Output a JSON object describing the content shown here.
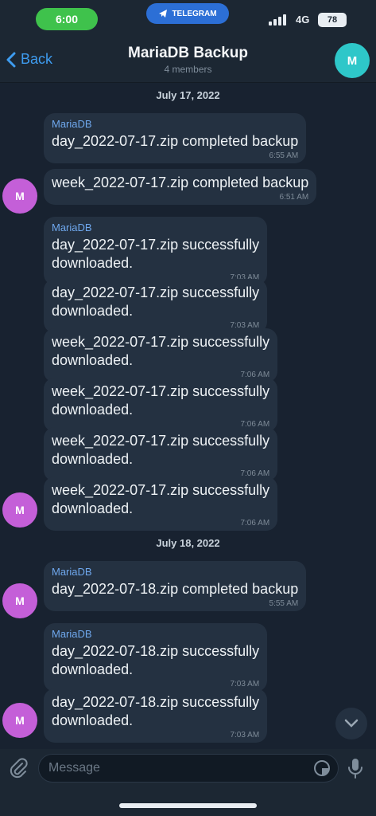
{
  "status": {
    "time": "6:00",
    "app": "TELEGRAM",
    "network": "4G",
    "battery": "78"
  },
  "header": {
    "back_label": "Back",
    "title": "MariaDB Backup",
    "subtitle": "4 members",
    "avatar_initial": "M"
  },
  "chat": {
    "dates": [
      "July 17, 2022",
      "July 18, 2022"
    ],
    "messages": [
      {
        "sender": "MariaDB",
        "text": "day_2022-07-17.zip completed backup",
        "time": "6:55 AM"
      },
      {
        "sender": "",
        "text": "week_2022-07-17.zip completed backup",
        "time": "6:51 AM"
      },
      {
        "sender": "MariaDB",
        "text": "day_2022-07-17.zip successfully\ndownloaded.",
        "time": "7:03 AM"
      },
      {
        "sender": "",
        "text": "day_2022-07-17.zip successfully\ndownloaded.",
        "time": "7:03 AM"
      },
      {
        "sender": "",
        "text": "week_2022-07-17.zip successfully\ndownloaded.",
        "time": "7:06 AM"
      },
      {
        "sender": "",
        "text": "week_2022-07-17.zip successfully\ndownloaded.",
        "time": "7:06 AM"
      },
      {
        "sender": "",
        "text": "week_2022-07-17.zip successfully\ndownloaded.",
        "time": "7:06 AM"
      },
      {
        "sender": "",
        "text": "week_2022-07-17.zip successfully\ndownloaded.",
        "time": "7:06 AM"
      },
      {
        "sender": "MariaDB",
        "text": "day_2022-07-18.zip completed backup",
        "time": "5:55 AM"
      },
      {
        "sender": "MariaDB",
        "text": "day_2022-07-18.zip successfully\ndownloaded.",
        "time": "7:03 AM"
      },
      {
        "sender": "",
        "text": "day_2022-07-18.zip successfully\ndownloaded.",
        "time": "7:03 AM"
      }
    ],
    "avatar_initial": "M"
  },
  "composer": {
    "placeholder": "Message"
  },
  "colors": {
    "accent": "#3e9cf0",
    "bubble": "#243141",
    "avatar": "#c45fd8",
    "header_avatar": "#2ec7c9"
  }
}
